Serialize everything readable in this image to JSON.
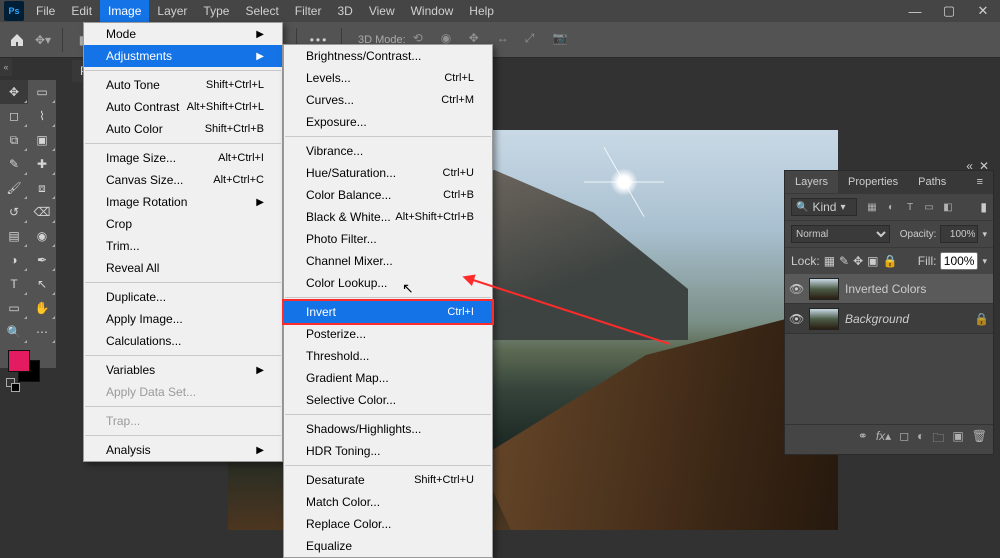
{
  "menubar": [
    "File",
    "Edit",
    "Image",
    "Layer",
    "Type",
    "Select",
    "Filter",
    "3D",
    "View",
    "Window",
    "Help"
  ],
  "menubar_open_index": 2,
  "options_bar": {
    "mode_label": "3D Mode:"
  },
  "doc_tab": {
    "label": "P"
  },
  "image_menu": [
    {
      "type": "item",
      "label": "Mode",
      "arrow": true
    },
    {
      "type": "item",
      "label": "Adjustments",
      "arrow": true,
      "hi": true
    },
    {
      "type": "sep"
    },
    {
      "type": "item",
      "label": "Auto Tone",
      "shortcut": "Shift+Ctrl+L"
    },
    {
      "type": "item",
      "label": "Auto Contrast",
      "shortcut": "Alt+Shift+Ctrl+L"
    },
    {
      "type": "item",
      "label": "Auto Color",
      "shortcut": "Shift+Ctrl+B"
    },
    {
      "type": "sep"
    },
    {
      "type": "item",
      "label": "Image Size...",
      "shortcut": "Alt+Ctrl+I"
    },
    {
      "type": "item",
      "label": "Canvas Size...",
      "shortcut": "Alt+Ctrl+C"
    },
    {
      "type": "item",
      "label": "Image Rotation",
      "arrow": true
    },
    {
      "type": "item",
      "label": "Crop"
    },
    {
      "type": "item",
      "label": "Trim..."
    },
    {
      "type": "item",
      "label": "Reveal All"
    },
    {
      "type": "sep"
    },
    {
      "type": "item",
      "label": "Duplicate..."
    },
    {
      "type": "item",
      "label": "Apply Image..."
    },
    {
      "type": "item",
      "label": "Calculations..."
    },
    {
      "type": "sep"
    },
    {
      "type": "item",
      "label": "Variables",
      "arrow": true
    },
    {
      "type": "item",
      "label": "Apply Data Set...",
      "disabled": true
    },
    {
      "type": "sep"
    },
    {
      "type": "item",
      "label": "Trap...",
      "disabled": true
    },
    {
      "type": "sep"
    },
    {
      "type": "item",
      "label": "Analysis",
      "arrow": true
    }
  ],
  "adjustments_menu": [
    {
      "type": "item",
      "label": "Brightness/Contrast..."
    },
    {
      "type": "item",
      "label": "Levels...",
      "shortcut": "Ctrl+L"
    },
    {
      "type": "item",
      "label": "Curves...",
      "shortcut": "Ctrl+M"
    },
    {
      "type": "item",
      "label": "Exposure..."
    },
    {
      "type": "sep"
    },
    {
      "type": "item",
      "label": "Vibrance..."
    },
    {
      "type": "item",
      "label": "Hue/Saturation...",
      "shortcut": "Ctrl+U"
    },
    {
      "type": "item",
      "label": "Color Balance...",
      "shortcut": "Ctrl+B"
    },
    {
      "type": "item",
      "label": "Black & White...",
      "shortcut": "Alt+Shift+Ctrl+B"
    },
    {
      "type": "item",
      "label": "Photo Filter..."
    },
    {
      "type": "item",
      "label": "Channel Mixer..."
    },
    {
      "type": "item",
      "label": "Color Lookup..."
    },
    {
      "type": "sep"
    },
    {
      "type": "item",
      "label": "Invert",
      "shortcut": "Ctrl+I",
      "invert_hi": true
    },
    {
      "type": "item",
      "label": "Posterize..."
    },
    {
      "type": "item",
      "label": "Threshold..."
    },
    {
      "type": "item",
      "label": "Gradient Map..."
    },
    {
      "type": "item",
      "label": "Selective Color..."
    },
    {
      "type": "sep"
    },
    {
      "type": "item",
      "label": "Shadows/Highlights..."
    },
    {
      "type": "item",
      "label": "HDR Toning..."
    },
    {
      "type": "sep"
    },
    {
      "type": "item",
      "label": "Desaturate",
      "shortcut": "Shift+Ctrl+U"
    },
    {
      "type": "item",
      "label": "Match Color..."
    },
    {
      "type": "item",
      "label": "Replace Color..."
    },
    {
      "type": "item",
      "label": "Equalize"
    }
  ],
  "tools": [
    {
      "name": "move-tool",
      "g": "✥"
    },
    {
      "name": "artboard-tool",
      "g": "▭"
    },
    {
      "name": "marquee-tool",
      "g": "◻"
    },
    {
      "name": "lasso-tool",
      "g": "⌇"
    },
    {
      "name": "crop-tool",
      "g": "⧉"
    },
    {
      "name": "frame-tool",
      "g": "▣"
    },
    {
      "name": "eyedropper-tool",
      "g": "✎"
    },
    {
      "name": "healing-tool",
      "g": "✚"
    },
    {
      "name": "brush-tool",
      "g": "🖌"
    },
    {
      "name": "clone-tool",
      "g": "⧈"
    },
    {
      "name": "history-brush",
      "g": "↺"
    },
    {
      "name": "eraser-tool",
      "g": "⌫"
    },
    {
      "name": "gradient-tool",
      "g": "▤"
    },
    {
      "name": "blur-tool",
      "g": "◉"
    },
    {
      "name": "dodge-tool",
      "g": "◑"
    },
    {
      "name": "pen-tool",
      "g": "✒"
    },
    {
      "name": "type-tool",
      "g": "T"
    },
    {
      "name": "path-tool",
      "g": "↖"
    },
    {
      "name": "shape-tool",
      "g": "▭"
    },
    {
      "name": "hand-tool",
      "g": "✋"
    },
    {
      "name": "zoom-tool",
      "g": "🔍"
    },
    {
      "name": "edit-toolbar",
      "g": "⋯"
    }
  ],
  "swatch": {
    "fg": "#e31b60",
    "bg": "#000000"
  },
  "layers_panel": {
    "tabs": [
      "Layers",
      "Properties",
      "Paths"
    ],
    "active_tab": 0,
    "kind_label": "Kind",
    "blend_mode": "Normal",
    "opacity_label": "Opacity:",
    "opacity_value": "100%",
    "lock_label": "Lock:",
    "fill_label": "Fill:",
    "fill_value": "100%",
    "layers": [
      {
        "name": "Inverted Colors",
        "visible": true,
        "selected": true,
        "locked": false,
        "italic": false
      },
      {
        "name": "Background",
        "visible": true,
        "selected": false,
        "locked": true,
        "italic": true
      }
    ],
    "footer_icons": [
      "link-icon",
      "fx-icon",
      "mask-icon",
      "adjustment-icon",
      "group-icon",
      "new-icon",
      "trash-icon"
    ]
  }
}
